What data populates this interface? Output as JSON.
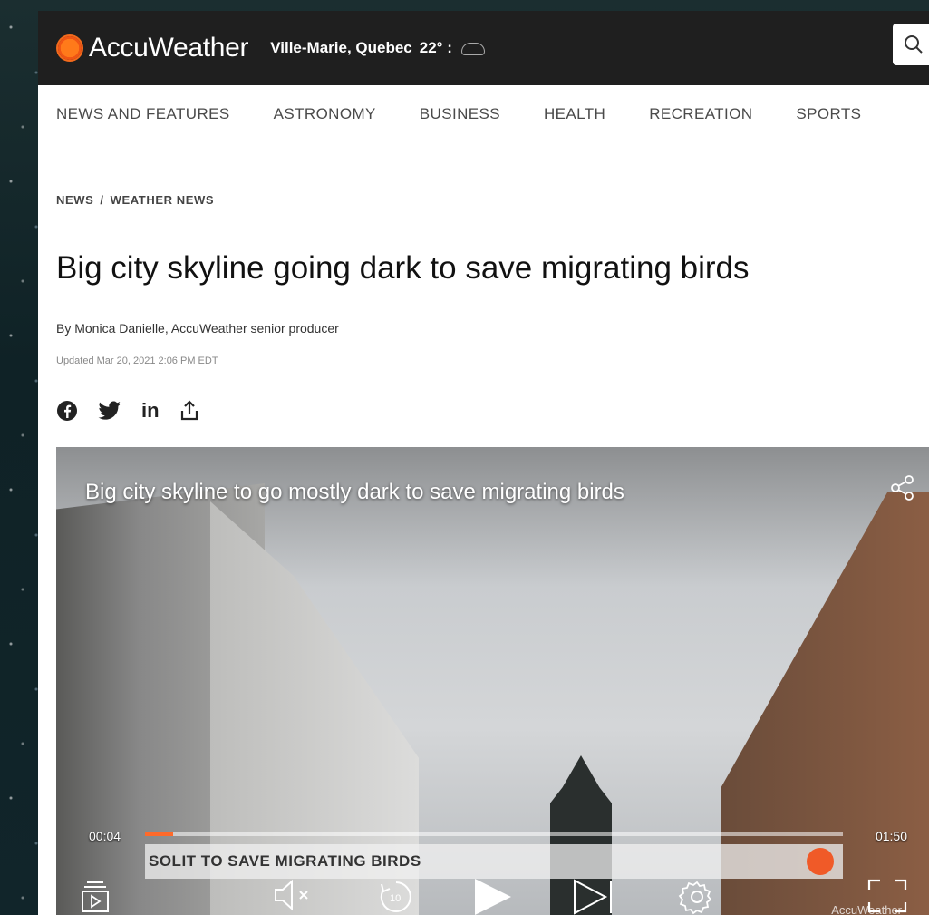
{
  "header": {
    "brand": "AccuWeather",
    "location": "Ville-Marie, Quebec",
    "temperature": "22° :",
    "weather_icon": "cloud-icon",
    "search_icon": "search-icon",
    "brand_color": "#f36a1c"
  },
  "nav": {
    "items": [
      {
        "label": "NEWS AND FEATURES"
      },
      {
        "label": "ASTRONOMY"
      },
      {
        "label": "BUSINESS"
      },
      {
        "label": "HEALTH"
      },
      {
        "label": "RECREATION"
      },
      {
        "label": "SPORTS"
      }
    ]
  },
  "breadcrumb": {
    "items": [
      "NEWS",
      "WEATHER NEWS"
    ],
    "separator": "/"
  },
  "article": {
    "title": "Big city skyline going dark to save migrating birds",
    "byline": "By Monica Danielle, AccuWeather senior producer",
    "updated": "Updated Mar 20, 2021 2:06 PM EDT"
  },
  "share": {
    "icons": [
      "facebook-icon",
      "twitter-icon",
      "linkedin-icon",
      "share-icon"
    ],
    "linkedin_label": "in"
  },
  "video": {
    "title": "Big city skyline to go mostly dark to save migrating birds",
    "current_time": "00:04",
    "duration": "01:50",
    "progress": 0.04,
    "caption": "SOLIT TO SAVE MIGRATING BIRDS",
    "watermark": "AccuWeather",
    "accent_color": "#ff6a2a"
  }
}
